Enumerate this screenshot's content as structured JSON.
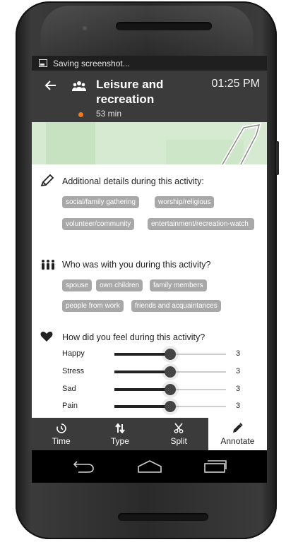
{
  "status_bar": {
    "notification": "Saving screenshot..."
  },
  "header": {
    "title": "Leisure and recreation",
    "time": "01:25 PM",
    "duration": "53 min",
    "dot_color": "#f07a1e"
  },
  "details": {
    "title": "Additional details during this activity:",
    "chips": [
      "social/family gathering",
      "worship/religious",
      "volunteer/community",
      "entertainment/recreation-watch"
    ]
  },
  "company": {
    "title": "Who was with you during this activity?",
    "chips": [
      "spouse",
      "own children",
      "family members",
      "people from work",
      "friends and acquaintances"
    ]
  },
  "feelings": {
    "title": "How did you feel during this activity?",
    "rows": [
      {
        "label": "Happy",
        "value": "3",
        "level": 0.5
      },
      {
        "label": "Stress",
        "value": "3",
        "level": 0.5
      },
      {
        "label": "Sad",
        "value": "3",
        "level": 0.5
      },
      {
        "label": "Pain",
        "value": "3",
        "level": 0.5
      }
    ]
  },
  "tabs": [
    {
      "label": "Time",
      "icon": "timer-icon"
    },
    {
      "label": "Type",
      "icon": "sort-arrows-icon"
    },
    {
      "label": "Split",
      "icon": "scissors-icon"
    },
    {
      "label": "Annotate",
      "icon": "pencil-icon",
      "active": true
    }
  ],
  "colors": {
    "header": "#3b3b3b",
    "chip": "#a8a8a8",
    "accent": "#f07a1e"
  }
}
